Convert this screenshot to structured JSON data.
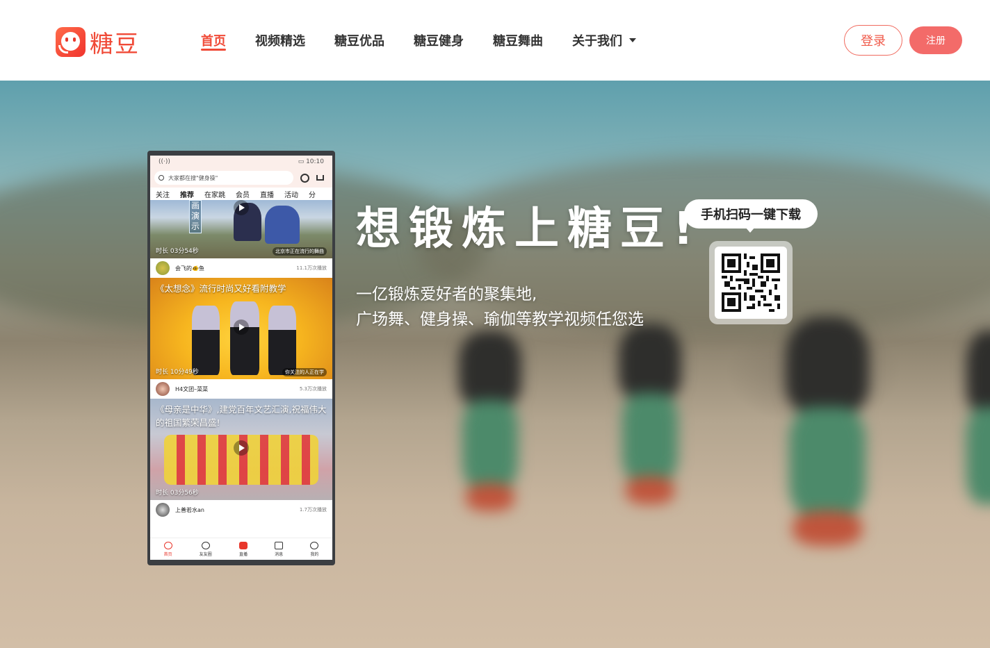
{
  "brand": {
    "name": "糖豆",
    "accent": "#f04a37"
  },
  "nav": {
    "items": [
      {
        "label": "首页",
        "active": true
      },
      {
        "label": "视频精选"
      },
      {
        "label": "糖豆优品"
      },
      {
        "label": "糖豆健身"
      },
      {
        "label": "糖豆舞曲"
      },
      {
        "label": "关于我们"
      }
    ]
  },
  "auth": {
    "login_label": "登录",
    "register_label": "注册"
  },
  "hero": {
    "slogan": "想锻炼上糖豆!",
    "subtitle_line1": "一亿锻炼爱好者的聚集地,",
    "subtitle_line2": "广场舞、健身操、瑜伽等教学视频任您选",
    "qr_prompt": "手机扫码一键下载"
  },
  "phone": {
    "time": "10:10",
    "search_placeholder": "大家都在搜\"健身操\"",
    "tabs": [
      "关注",
      "推荐",
      "在家跳",
      "会员",
      "直播",
      "活动",
      "分"
    ],
    "active_tab": "推荐",
    "videos": [
      {
        "title": "",
        "duration": "时长 03分54秒",
        "tag": "北京市正在流行的舞曲",
        "overlay_text": "画演示",
        "user": "会飞的🐠鱼",
        "views": "11.1万次播放"
      },
      {
        "title": "《太想念》流行时尚又好看附教学",
        "duration": "时长 10分49秒",
        "tag": "你关注的人正在学",
        "user": "H4文团–菜菜",
        "views": "5.3万次播放"
      },
      {
        "title": "《母亲是中华》,建党百年文艺汇演,祝福伟大的祖国繁荣昌盛!",
        "duration": "时长 03分56秒",
        "user": "上善若水an",
        "views": "1.7万次播放"
      }
    ],
    "bottom_nav": [
      "首页",
      "友友圈",
      "直播",
      "消息",
      "我的"
    ]
  }
}
